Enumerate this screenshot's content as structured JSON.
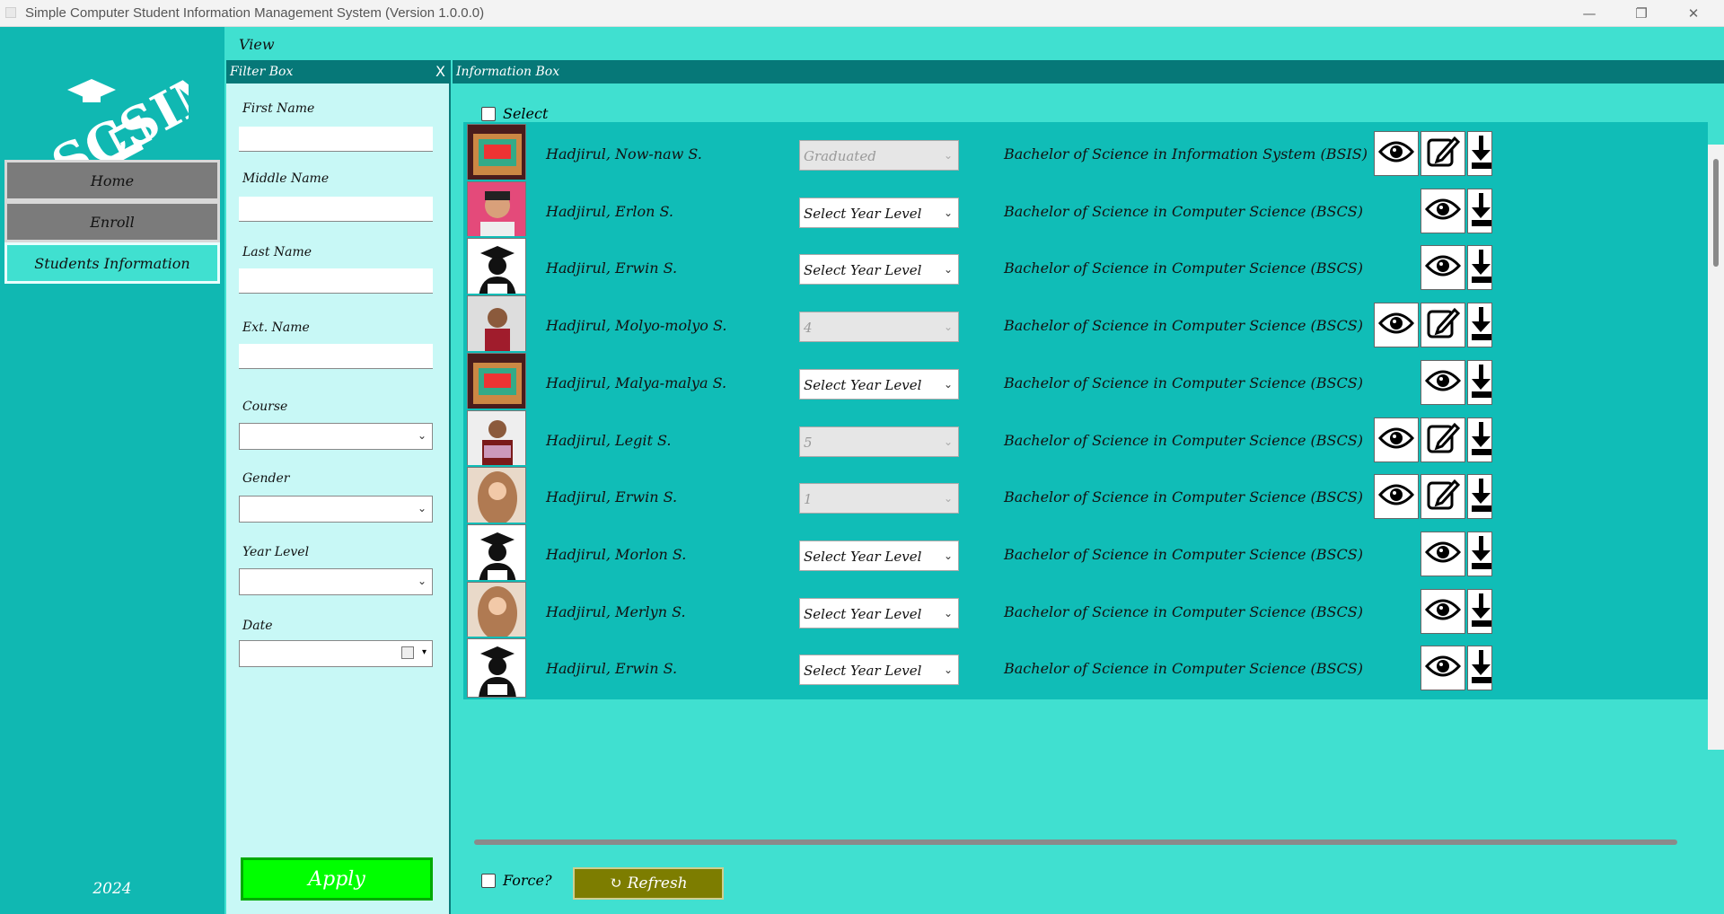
{
  "window": {
    "title": "Simple Computer Student Information Management System (Version 1.0.0.0)",
    "minimize_glyph": "—",
    "restore_glyph": "❐",
    "close_glyph": "✕"
  },
  "sidebar": {
    "logo_text": "SCSIMS",
    "items": [
      {
        "label": "Home"
      },
      {
        "label": "Enroll"
      },
      {
        "label": "Students Information"
      }
    ],
    "year": "2024"
  },
  "view": {
    "title": "View"
  },
  "filter": {
    "title": "Filter Box",
    "close": "X",
    "fields": {
      "first_name": "First Name",
      "middle_name": "Middle Name",
      "last_name": "Last Name",
      "ext_name": "Ext. Name",
      "course": "Course",
      "gender": "Gender",
      "year_level": "Year Level",
      "date": "Date"
    },
    "apply": "Apply"
  },
  "info": {
    "title": "Information Box",
    "select_label": "Select",
    "force_label": "Force?",
    "refresh_label": "Refresh",
    "rows": [
      {
        "name": "Hadjirul, Now-naw S.",
        "year": "Graduated",
        "disabled": true,
        "course": "Bachelor of Science in Information System (BSIS)",
        "edit": true,
        "photo": "banner"
      },
      {
        "name": "Hadjirul, Erlon S.",
        "year": "Select Year Level",
        "disabled": false,
        "course": "Bachelor of Science in Computer Science (BSCS)",
        "edit": false,
        "photo": "boy"
      },
      {
        "name": "Hadjirul, Erwin S.",
        "year": "Select Year Level",
        "disabled": false,
        "course": "Bachelor of Science in Computer Science (BSCS)",
        "edit": false,
        "photo": "grad"
      },
      {
        "name": "Hadjirul, Molyo-molyo S.",
        "year": "4",
        "disabled": true,
        "course": "Bachelor of Science in Computer Science (BSCS)",
        "edit": true,
        "photo": "boy2"
      },
      {
        "name": "Hadjirul, Malya-malya S.",
        "year": "Select Year Level",
        "disabled": false,
        "course": "Bachelor of Science in Computer Science (BSCS)",
        "edit": false,
        "photo": "banner"
      },
      {
        "name": "Hadjirul, Legit S.",
        "year": "5",
        "disabled": true,
        "course": "Bachelor of Science in Computer Science (BSCS)",
        "edit": true,
        "photo": "reader"
      },
      {
        "name": "Hadjirul, Erwin S.",
        "year": "1",
        "disabled": true,
        "course": "Bachelor of Science in Computer Science (BSCS)",
        "edit": true,
        "photo": "hijab"
      },
      {
        "name": "Hadjirul, Morlon S.",
        "year": "Select Year Level",
        "disabled": false,
        "course": "Bachelor of Science in Computer Science (BSCS)",
        "edit": false,
        "photo": "grad"
      },
      {
        "name": "Hadjirul, Merlyn S.",
        "year": "Select Year Level",
        "disabled": false,
        "course": "Bachelor of Science in Computer Science (BSCS)",
        "edit": false,
        "photo": "hijab"
      },
      {
        "name": "Hadjirul, Erwin S.",
        "year": "Select Year Level",
        "disabled": false,
        "course": "Bachelor of Science in Computer Science (BSCS)",
        "edit": false,
        "photo": "grad"
      }
    ]
  },
  "colors": {
    "accent": "#40E0D0",
    "sidebar": "#10B8B2",
    "header": "#067878",
    "apply": "#00FF00",
    "refresh": "#7D7D00"
  }
}
